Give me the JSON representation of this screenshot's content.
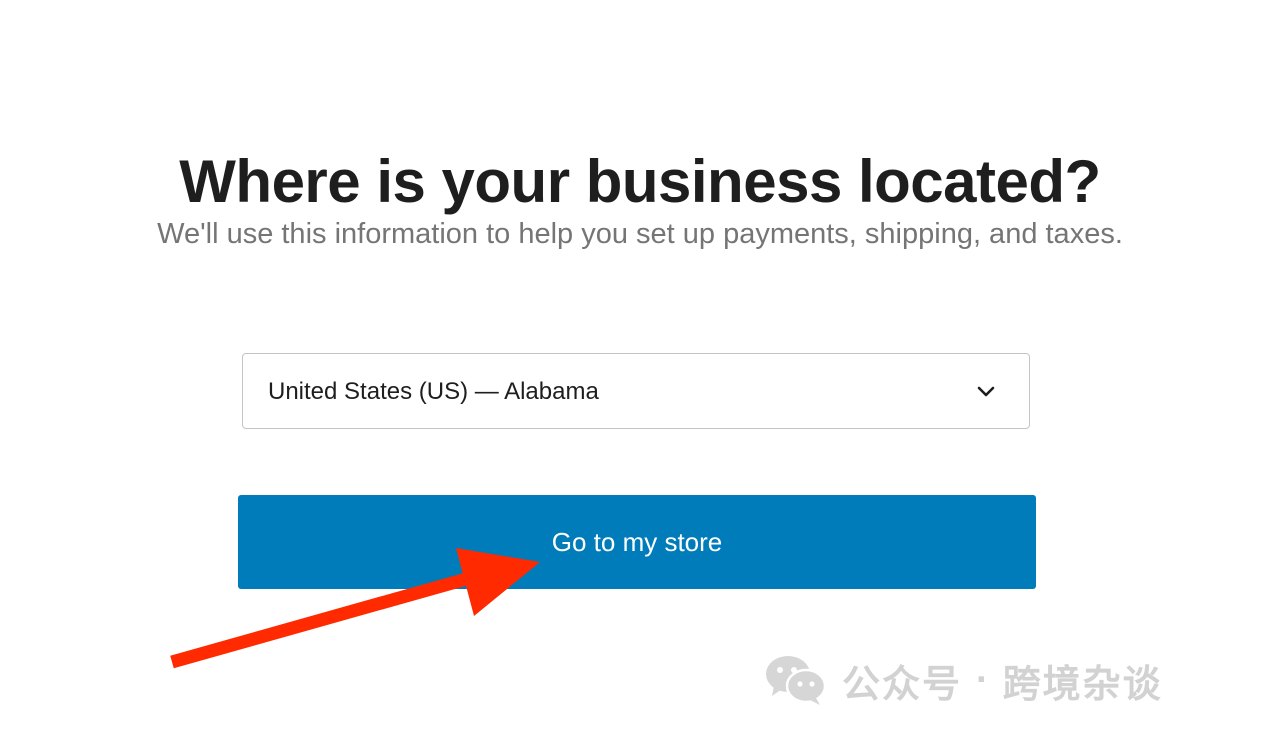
{
  "header": {
    "title": "Where is your business located?",
    "subtitle": "We'll use this information to help you set up payments, shipping, and taxes."
  },
  "location": {
    "selected": "United States (US) — Alabama",
    "icon": "chevron-down-icon"
  },
  "actions": {
    "primary_label": "Go to my store",
    "primary_color": "#007cba"
  },
  "annotation": {
    "arrow_color": "#ff2a00",
    "icon": "arrow-icon"
  },
  "watermark": {
    "icon": "wechat-icon",
    "account_label": "公众号",
    "separator": "·",
    "account_name": "跨境杂谈"
  }
}
